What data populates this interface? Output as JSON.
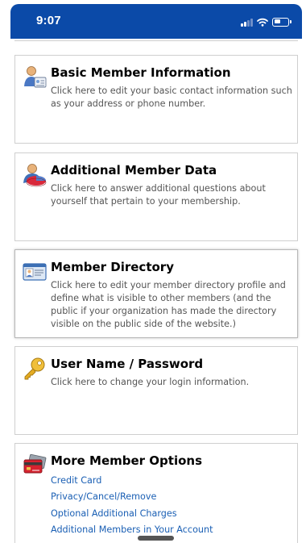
{
  "status_bar": {
    "time": "9:07"
  },
  "cards": [
    {
      "title": "Basic Member Information",
      "description": "Click here to edit your basic contact information such as your address or phone number.",
      "icon": "member-card-icon"
    },
    {
      "title": "Additional Member Data",
      "description": "Click here to answer additional questions about yourself that pertain to your membership.",
      "icon": "person-pie-icon"
    },
    {
      "title": "Member Directory",
      "description": "Click here to edit your member directory profile and define what is visible to other members (and the public if your organization has made the directory visible on the public side of the website.)",
      "icon": "directory-card-icon"
    },
    {
      "title": "User Name / Password",
      "description": "Click here to change your login information.",
      "icon": "key-icon"
    }
  ],
  "more_options": {
    "title": "More Member Options",
    "icon": "credit-cards-icon",
    "links": [
      "Credit Card",
      "Privacy/Cancel/Remove",
      "Optional Additional Charges",
      "Additional Members in Your Account"
    ]
  },
  "colors": {
    "status_bar": "#0b4aa8",
    "link": "#1a5fb4"
  }
}
